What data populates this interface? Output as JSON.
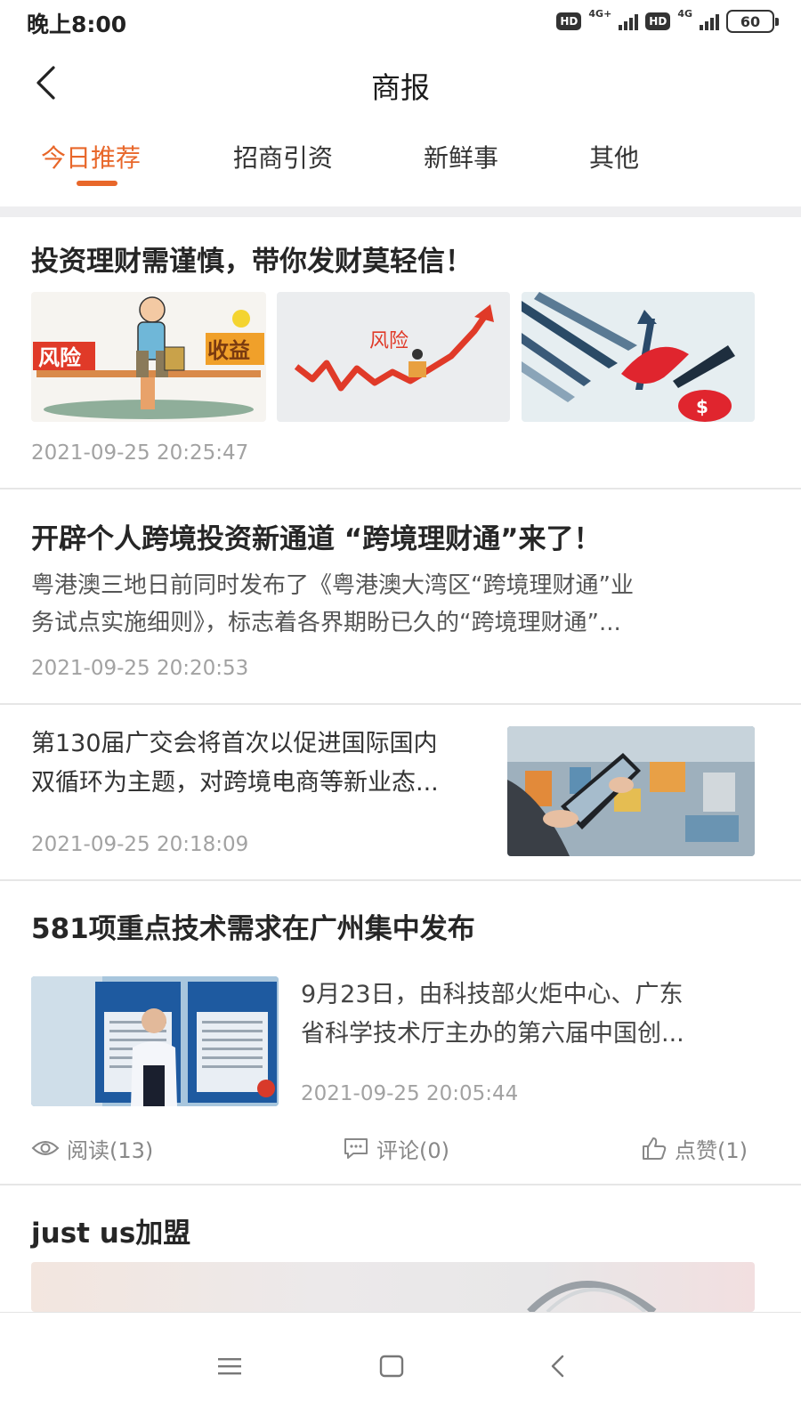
{
  "status_bar": {
    "time": "晚上8:00",
    "hd1": "HD",
    "net1": "4G+",
    "hd2": "HD",
    "net2": "4G",
    "battery": "60"
  },
  "header": {
    "title": "商报",
    "back_icon": "chevron-left-icon"
  },
  "tabs": [
    {
      "label": "今日推荐",
      "active": true
    },
    {
      "label": "招商引资",
      "active": false
    },
    {
      "label": "新鲜事",
      "active": false
    },
    {
      "label": "其他",
      "active": false
    }
  ],
  "accent_color": "#e8672a",
  "articles": [
    {
      "title": "投资理财需谨慎，带你发财莫轻信！",
      "time": "2021-09-25 20:25:47",
      "images": [
        {
          "desc": "seesaw-illustration",
          "text_left": "风险",
          "text_right": "收益"
        },
        {
          "desc": "rising-arrow-illustration",
          "text": "风险"
        },
        {
          "desc": "umbrella-piggy-illustration",
          "text": "$"
        }
      ]
    },
    {
      "title": "开辟个人跨境投资新通道 “跨境理财通”来了！",
      "summary_line1": "粤港澳三地日前同时发布了《粤港澳大湾区“跨境理财通”业",
      "summary_line2": "务试点实施细则》，标志着各界期盼已久的“跨境理财通”...",
      "time": "2021-09-25 20:20:53"
    },
    {
      "title_line1": "第130届广交会将首次以促进国际国内",
      "title_line2": "双循环为主题，对跨境电商等新业态...",
      "time": "2021-09-25 20:18:09"
    },
    {
      "title": "581项重点技术需求在广州集中发布",
      "summary_line1": "9月23日，由科技部火炬中心、广东",
      "summary_line2": "省科学技术厅主办的第六届中国创...",
      "time": "2021-09-25 20:05:44",
      "read_label": "阅读(13)",
      "comment_label": "评论(0)",
      "like_label": "点赞(1)"
    },
    {
      "title": "just us加盟"
    }
  ],
  "bottom_nav": {
    "menu_icon": "menu-icon",
    "home_icon": "home-square-icon",
    "back_icon": "back-triangle-icon"
  }
}
